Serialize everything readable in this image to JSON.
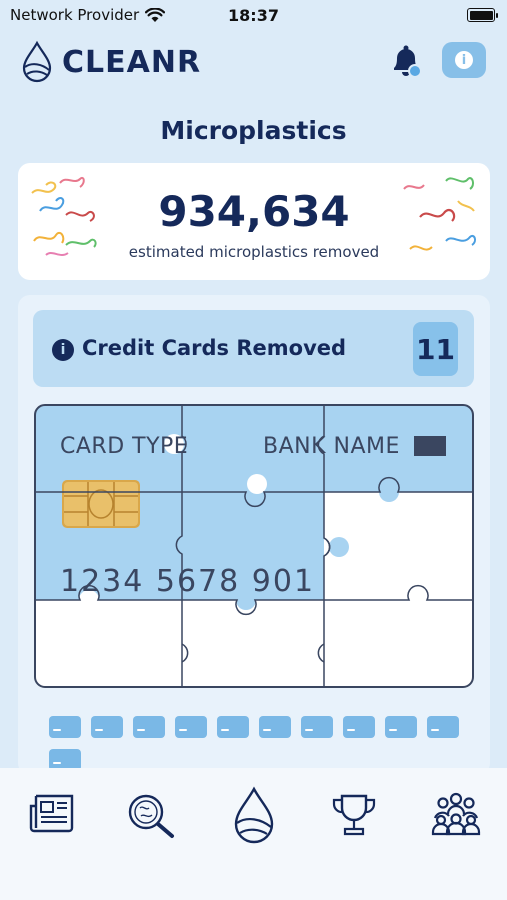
{
  "status_bar": {
    "carrier": "Network Provider",
    "time": "18:37"
  },
  "header": {
    "app_name": "CLEANR",
    "icons": [
      "water-drop-logo-icon",
      "bell-icon",
      "info-icon"
    ]
  },
  "page_title": "Microplastics",
  "stat": {
    "value": "934,634",
    "label": "estimated microplastics removed"
  },
  "credit_cards": {
    "label": "Credit Cards Removed",
    "count": "11",
    "card": {
      "card_type": "CARD TYPE",
      "bank_name": "BANK NAME",
      "number": "1234  5678  901"
    },
    "pieces_filled": 5,
    "pieces_total": 9,
    "mini_cards_count": 11
  },
  "tab_bar": {
    "tabs": [
      "news-icon",
      "microscope-search-icon",
      "water-drop-icon",
      "trophy-icon",
      "community-icon"
    ]
  },
  "colors": {
    "background": "#dcebf8",
    "navy": "#15295a",
    "light_blue": "#bcdcf3",
    "card_blue": "#a8d3f1",
    "mini_card_blue": "#7ab8e6"
  }
}
